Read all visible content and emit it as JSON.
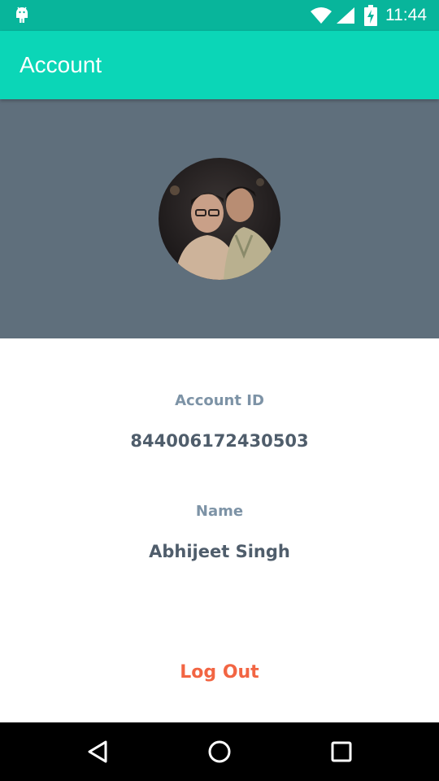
{
  "status_bar": {
    "time": "11:44",
    "icons": [
      "android-icon",
      "wifi-icon",
      "signal-icon",
      "battery-charging-icon"
    ]
  },
  "app_bar": {
    "title": "Account",
    "color": "#0bd6b7"
  },
  "profile": {
    "header_color": "#5f6f7c",
    "avatar": "profile-photo"
  },
  "account": {
    "id_label": "Account ID",
    "id_value": "844006172430503",
    "name_label": "Name",
    "name_value": "Abhijeet Singh"
  },
  "actions": {
    "logout_label": "Log Out",
    "logout_color": "#f26543"
  },
  "nav_bar": {
    "icons": [
      "back-icon",
      "home-icon",
      "recents-icon"
    ]
  }
}
